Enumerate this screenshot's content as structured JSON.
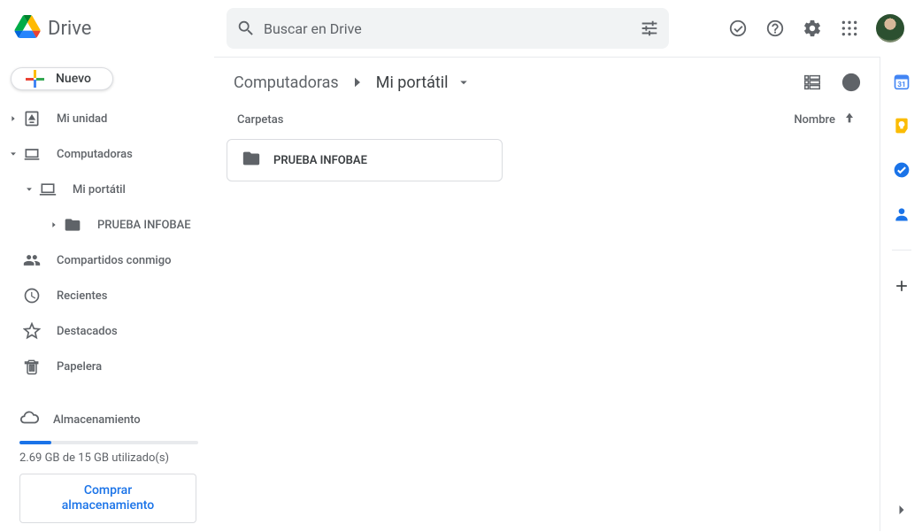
{
  "brand": {
    "name": "Drive"
  },
  "search": {
    "placeholder": "Buscar en Drive"
  },
  "new_button": {
    "label": "Nuevo"
  },
  "sidebar": {
    "my_drive": "Mi unidad",
    "computers": "Computadoras",
    "my_laptop": "Mi portátil",
    "folder_test": "PRUEBA INFOBAE",
    "shared": "Compartidos conmigo",
    "recent": "Recientes",
    "starred": "Destacados",
    "trash": "Papelera",
    "storage": "Almacenamiento"
  },
  "storage": {
    "used_text": "2.69 GB de 15 GB utilizado(s)",
    "buy_line1": "Comprar",
    "buy_line2": "almacenamiento"
  },
  "breadcrumb": {
    "root": "Computadoras",
    "current": "Mi portátil"
  },
  "list": {
    "section_title": "Carpetas",
    "sort_label": "Nombre",
    "folders": [
      {
        "name": "PRUEBA INFOBAE"
      }
    ]
  }
}
